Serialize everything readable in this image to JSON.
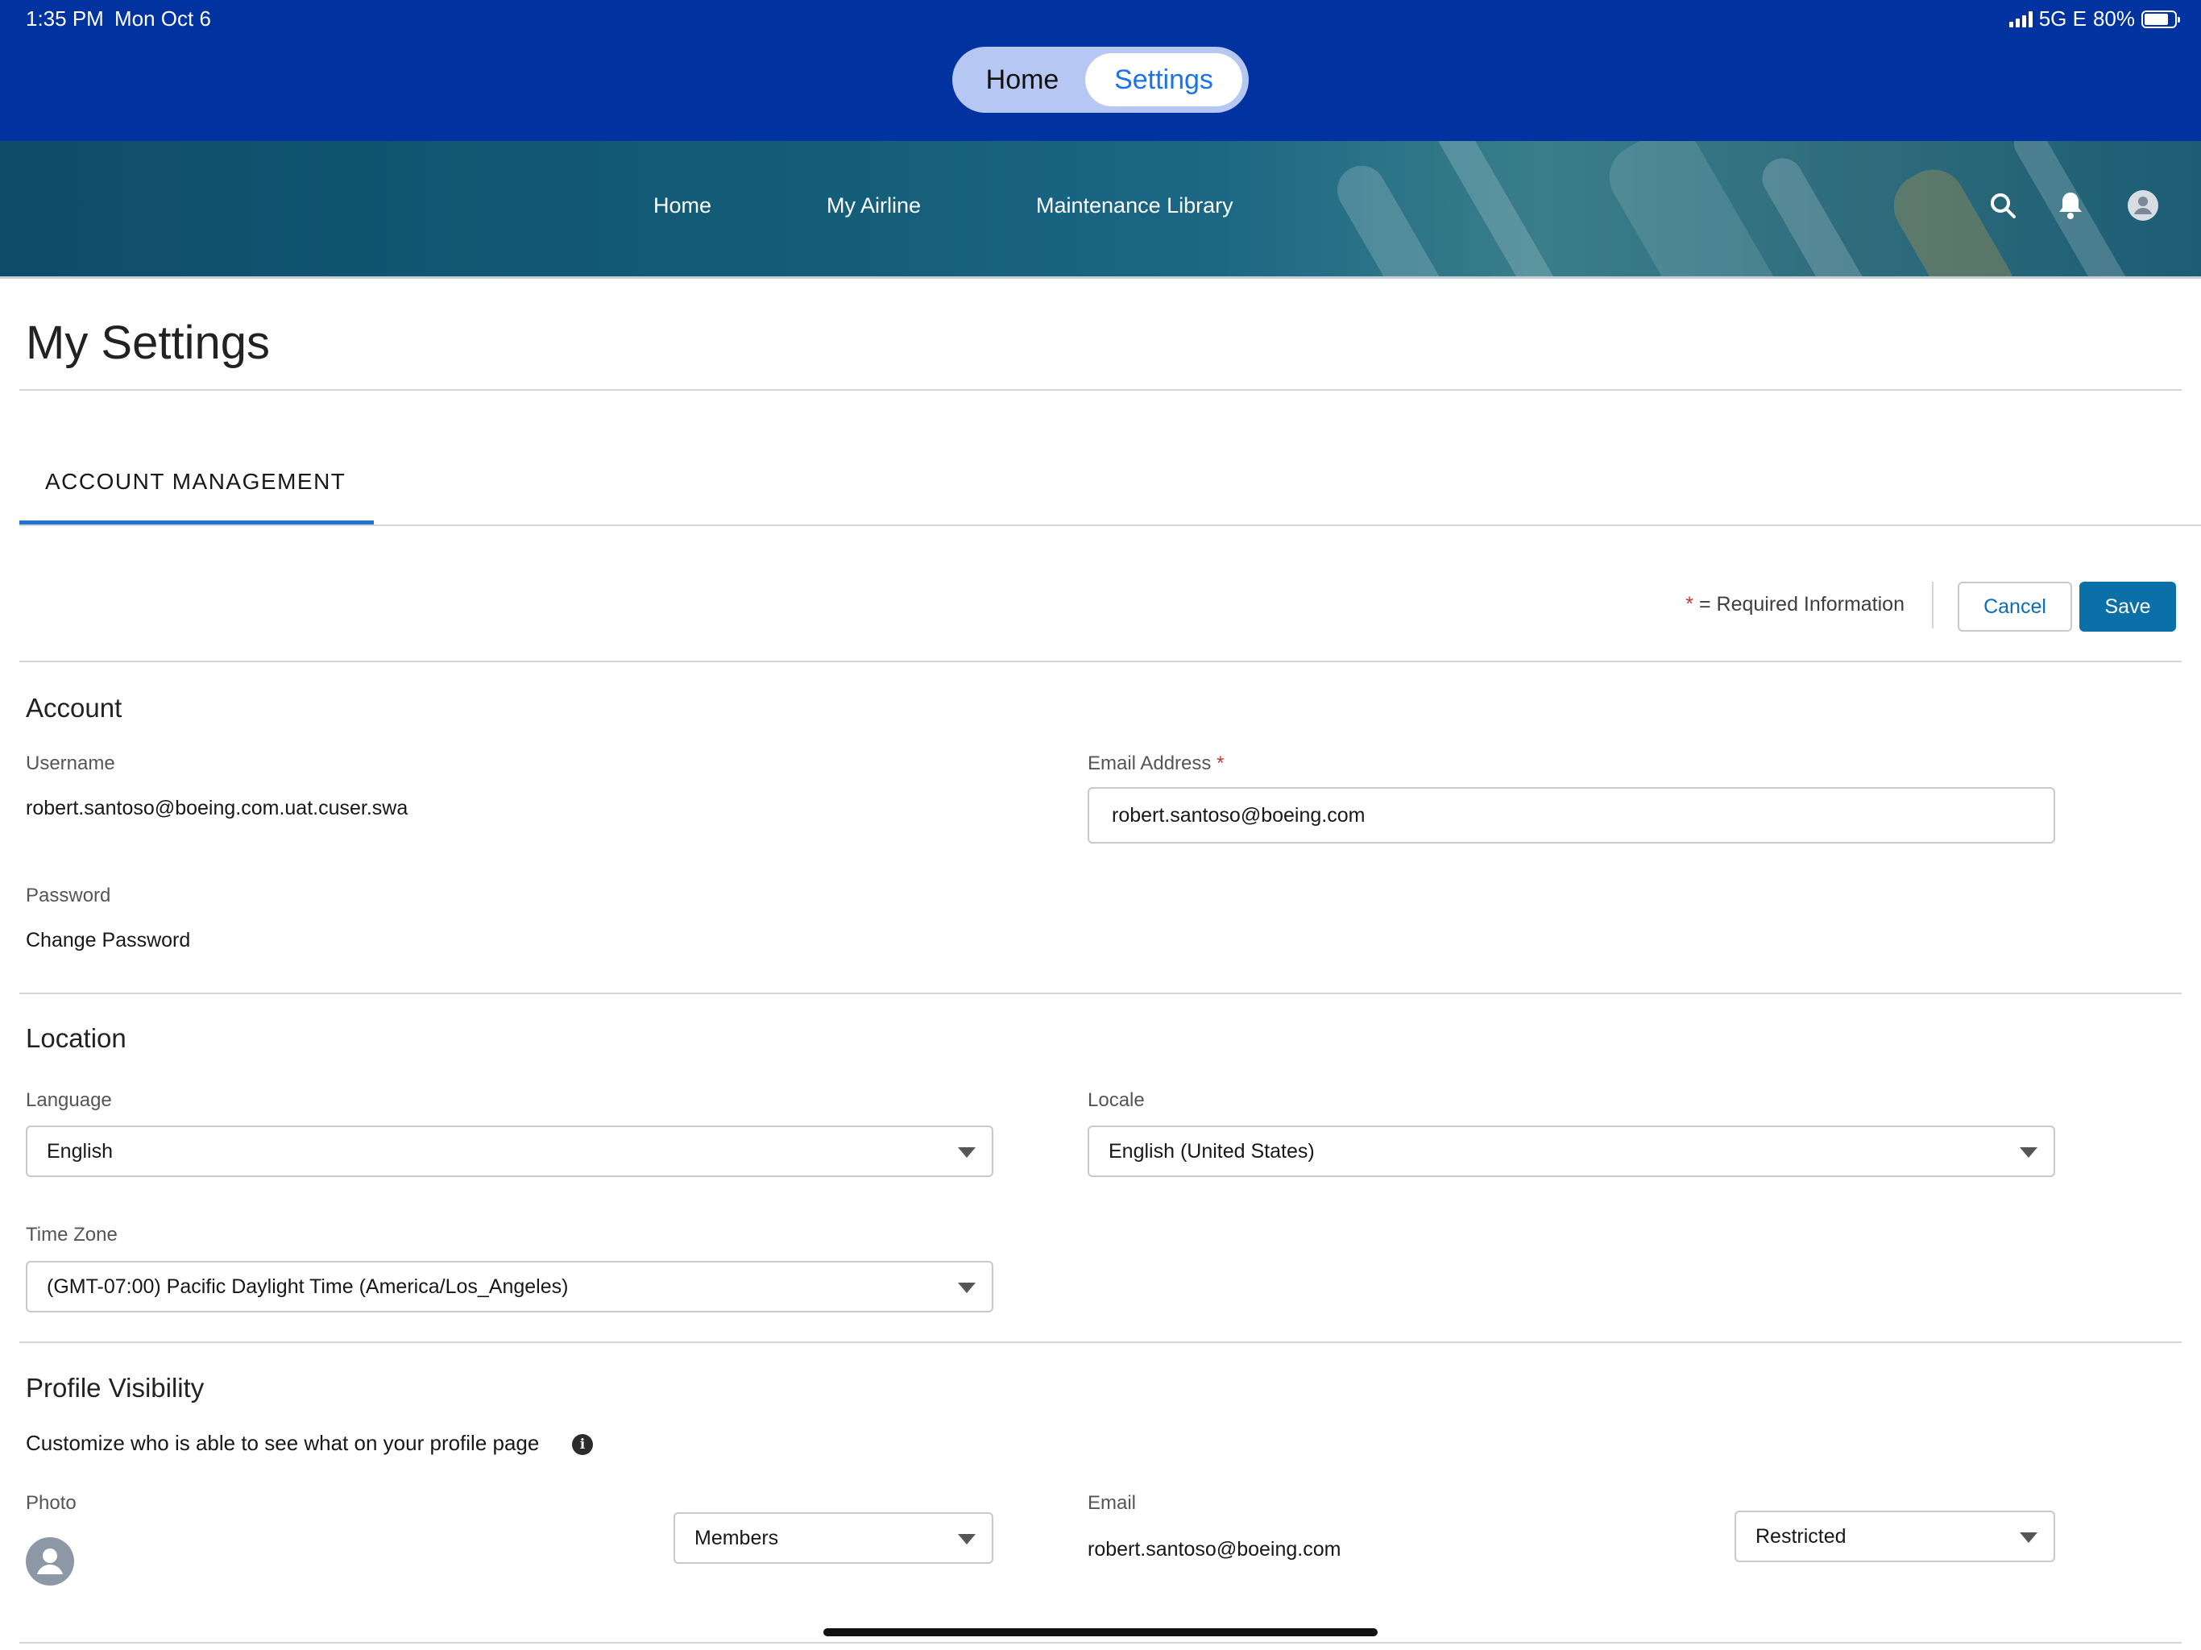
{
  "status_bar": {
    "time": "1:35 PM",
    "date": "Mon Oct 6",
    "network": "5G E",
    "battery": "80%",
    "battery_level": 0.8
  },
  "toggle": {
    "home_label": "Home",
    "settings_label": "Settings",
    "selected": "Settings"
  },
  "nav": {
    "items": [
      {
        "label": "Home"
      },
      {
        "label": "My Airline"
      },
      {
        "label": "Maintenance Library"
      }
    ],
    "icons": [
      "search-icon",
      "bell-icon",
      "user-avatar-icon"
    ]
  },
  "page": {
    "title": "My Settings",
    "tab": "ACCOUNT MANAGEMENT"
  },
  "actions": {
    "required_star": "*",
    "required_text": "= Required Information",
    "cancel_label": "Cancel",
    "save_label": "Save"
  },
  "account": {
    "title": "Account",
    "username_label": "Username",
    "username_value": "robert.santoso@boeing.com.uat.cuser.swa",
    "email_label": "Email Address",
    "email_star": "*",
    "email_value": "robert.santoso@boeing.com",
    "password_label": "Password",
    "change_password": "Change Password"
  },
  "location": {
    "title": "Location",
    "language_label": "Language",
    "language_value": "English",
    "locale_label": "Locale",
    "locale_value": "English (United States)",
    "timezone_label": "Time Zone",
    "timezone_value": "(GMT-07:00) Pacific Daylight Time (America/Los_Angeles)"
  },
  "profile_visibility": {
    "title": "Profile Visibility",
    "description": "Customize who is able to see what on your profile page",
    "photo_label": "Photo",
    "photo_visibility": "Members",
    "email_label": "Email",
    "email_value": "robert.santoso@boeing.com",
    "email_visibility": "Restricted"
  },
  "colors": {
    "top_bar": "#0032a0",
    "accent": "#1f74d1",
    "save_button": "#0b70a8",
    "required": "#c23934"
  }
}
